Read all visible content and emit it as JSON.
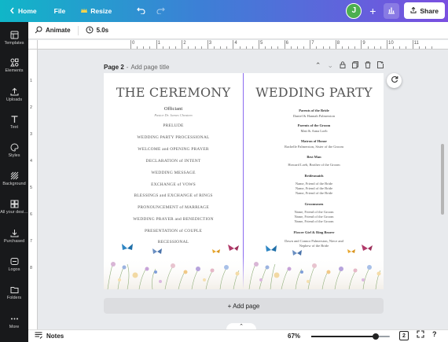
{
  "topbar": {
    "home": "Home",
    "file": "File",
    "resize": "Resize",
    "avatar": "J",
    "share": "Share",
    "colors": {
      "brand_start": "#10b6c8",
      "brand_end": "#7a4fe0",
      "avatar": "#4caf50"
    }
  },
  "subbar": {
    "animate": "Animate",
    "duration": "5.0s"
  },
  "sidebar": {
    "items": [
      {
        "label": "Templates",
        "icon": "templates-icon"
      },
      {
        "label": "Elements",
        "icon": "elements-icon"
      },
      {
        "label": "Uploads",
        "icon": "upload-icon"
      },
      {
        "label": "Text",
        "icon": "text-icon"
      },
      {
        "label": "Styles",
        "icon": "palette-icon"
      },
      {
        "label": "Background",
        "icon": "background-icon"
      },
      {
        "label": "All your desi…",
        "icon": "folder-grid-icon"
      },
      {
        "label": "Purchased",
        "icon": "download-icon"
      },
      {
        "label": "Logos",
        "icon": "logo-icon"
      },
      {
        "label": "Folders",
        "icon": "folder-icon"
      },
      {
        "label": "More",
        "icon": "more-icon"
      }
    ]
  },
  "ruler": {
    "top": [
      "0",
      "1",
      "2",
      "3",
      "4",
      "5",
      "6",
      "7",
      "8",
      "9",
      "10",
      "11"
    ],
    "left": [
      "1",
      "2",
      "3",
      "4",
      "5",
      "6",
      "7",
      "8"
    ]
  },
  "page": {
    "label": "Page 2",
    "separator": "-",
    "add_title": "Add page title",
    "left": {
      "title": "THE CEREMONY",
      "officiant": "Officiant",
      "officiant_name": "Pastor Dr. James Cheatem",
      "program": [
        "PRELUDE",
        "WEDDING PARTY PROCESSIONAL",
        "WELCOME and OPENING PRAYER",
        "DECLARATION of INTENT",
        "WEDDING MESSAGE",
        "EXCHANGE of VOWS",
        "BLESSINGS and EXCHANGE of RINGS",
        "PRONOUNCEMENT of MARRIAGE",
        "WEDDING PRAYER and BENEDICTION",
        "PRESENTATION of COUPLE",
        "RECESSIONAL"
      ]
    },
    "right": {
      "title": "WEDDING PARTY",
      "groups": [
        {
          "head": "Parents of the Bride",
          "lines": [
            "Daniel & Hannah Palmerston"
          ]
        },
        {
          "head": "Parents of the Groom",
          "lines": [
            "Matt & Anna Loeb"
          ]
        },
        {
          "head": "Matron of Honor",
          "lines": [
            "Rachelle Palmerston, Sister of the Groom"
          ]
        },
        {
          "head": "Best Man",
          "lines": [
            "Howard Loeb, Brother of the Groom"
          ]
        },
        {
          "head": "Bridesmaids",
          "lines": [
            "Name, Friend of the Bride",
            "Name, Friend of the Bride",
            "Name, Friend of the Bride"
          ]
        },
        {
          "head": "Groomsmen",
          "lines": [
            "Name, Friend of the Groom",
            "Name, Friend of the Groom",
            "Name, Friend of the Groom"
          ]
        },
        {
          "head": "Flower Girl & Ring Bearer",
          "lines": [
            "Dawn and Connor Palmerston, Niece and",
            "Nephew of the Bride"
          ]
        }
      ]
    }
  },
  "add_page": "+ Add page",
  "bottombar": {
    "notes": "Notes",
    "zoom": "67%",
    "zoom_fraction": 0.82,
    "pages_count": "2"
  }
}
